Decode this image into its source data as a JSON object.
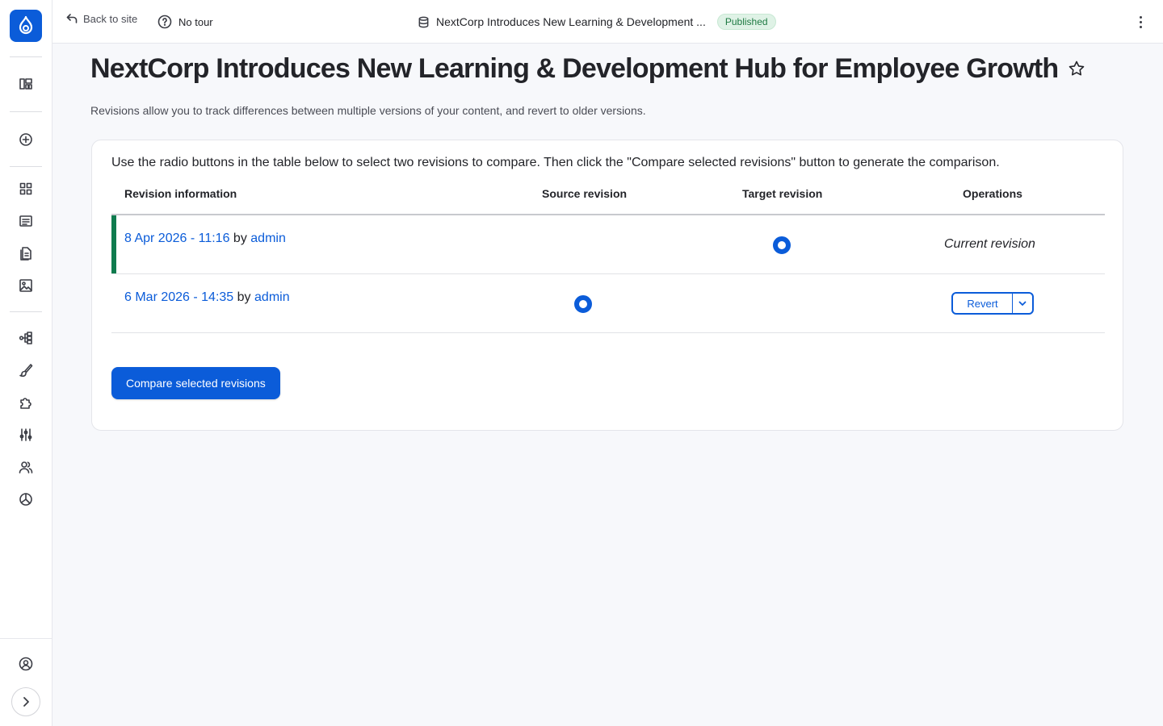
{
  "topbar": {
    "back_label": "Back to site",
    "tour_label": "No tour",
    "doc_title": "NextCorp Introduces New Learning & Development ...",
    "status_badge": "Published"
  },
  "page": {
    "title": "NextCorp Introduces New Learning & Development Hub for Employee Growth",
    "description": "Revisions allow you to track differences between multiple versions of your content, and revert to older versions."
  },
  "revisions": {
    "instructions": "Use the radio buttons in the table below to select two revisions to compare. Then click the \"Compare selected revisions\" button to generate the comparison.",
    "headers": {
      "info": "Revision information",
      "source": "Source revision",
      "target": "Target revision",
      "operations": "Operations"
    },
    "rows": [
      {
        "date": "8 Apr 2026 - 11:16",
        "by": "by",
        "author": "admin",
        "operation": "Current revision"
      },
      {
        "date": "6 Mar 2026 - 14:35",
        "by": "by",
        "author": "admin",
        "operation": "Revert"
      }
    ],
    "compare_button": "Compare selected revisions"
  },
  "colors": {
    "accent": "#0b5cd9",
    "current_marker": "#0f7b4e",
    "badge_bg": "#dff2e6",
    "badge_text": "#1e7a43"
  },
  "sidebar_icons": [
    "drupal-logo-icon",
    "dashboard-icon",
    "add-icon",
    "content-icon",
    "list-icon",
    "files-icon",
    "media-icon",
    "structure-icon",
    "appearance-icon",
    "extend-icon",
    "configuration-icon",
    "people-icon",
    "reports-icon",
    "user-account-icon",
    "expand-icon"
  ]
}
